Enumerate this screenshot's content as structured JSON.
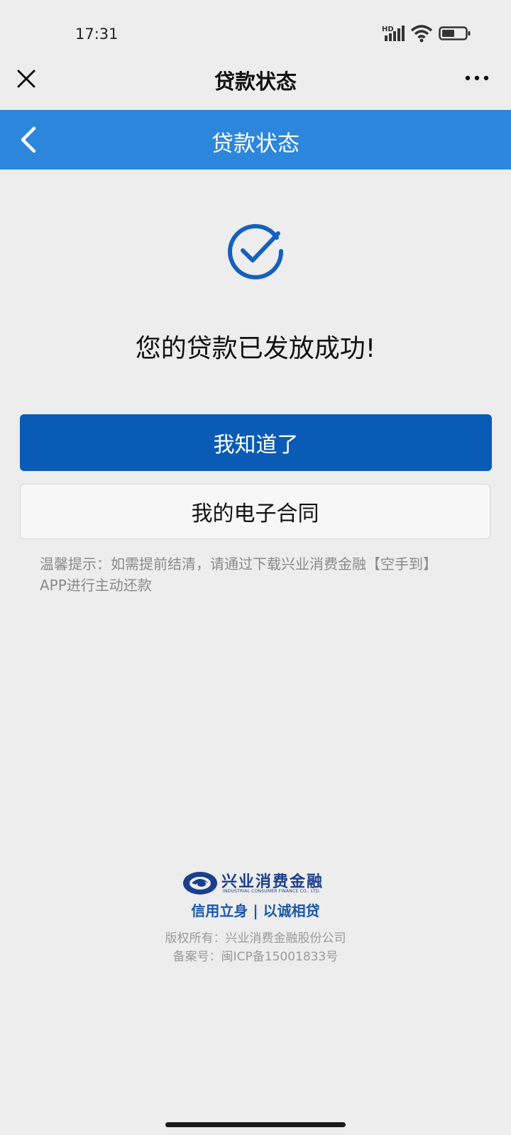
{
  "status_bar": {
    "time": "17:31",
    "icons": [
      "hd-signal-icon",
      "wifi-icon",
      "battery-icon"
    ]
  },
  "wechat_header": {
    "title": "贷款状态",
    "close_icon": "close-icon",
    "more_icon": "more-icon"
  },
  "page_bar": {
    "title": "贷款状态",
    "back_icon": "chevron-left-icon",
    "color": "#2b86dc"
  },
  "main": {
    "status_icon": "check-circle-icon",
    "status_text": "您的贷款已发放成功!",
    "primary_button": "我知道了",
    "secondary_button": "我的电子合同",
    "tip_line1": "温馨提示：如需提前结清，请通过下载兴业消费金融【空手到】",
    "tip_line2": "APP进行主动还款",
    "accent_color": "#0a5bb5"
  },
  "footer": {
    "logo_name": "兴业消费金融",
    "logo_en": "INDUSTRIAL CONSUMER FINANCE CO., LTD.",
    "slogan": "信用立身 | 以诚相贷",
    "copyright": "版权所有：兴业消费金融股份公司",
    "icp": "备案号：闽ICP备15001833号"
  }
}
